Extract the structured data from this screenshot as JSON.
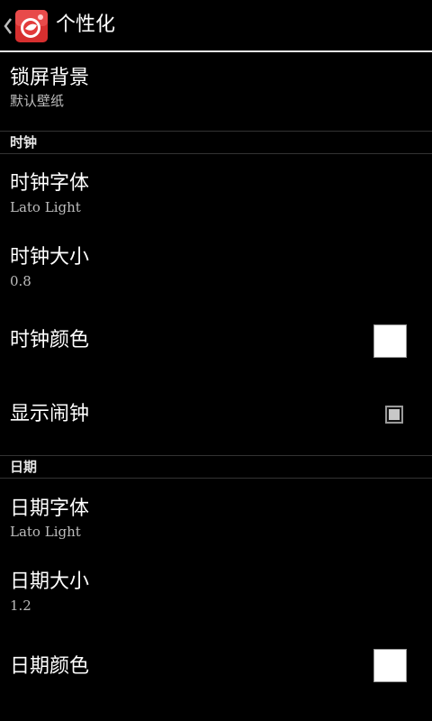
{
  "action_bar": {
    "title": "个性化",
    "app_icon": "app-logo-icon",
    "up_icon": "chevron-left-icon"
  },
  "preferences": {
    "lock_background": {
      "title": "锁屏背景",
      "summary": "默认壁纸"
    },
    "category_clock": "时钟",
    "clock_font": {
      "title": "时钟字体",
      "summary": "Lato Light"
    },
    "clock_size": {
      "title": "时钟大小",
      "summary": "0.8"
    },
    "clock_color": {
      "title": "时钟颜色",
      "color": "#ffffff"
    },
    "show_alarm": {
      "title": "显示闹钟",
      "checked": true
    },
    "category_date": "日期",
    "date_font": {
      "title": "日期字体",
      "summary": "Lato Light"
    },
    "date_size": {
      "title": "日期大小",
      "summary": "1.2"
    },
    "date_color": {
      "title": "日期颜色",
      "color": "#ffffff"
    }
  },
  "colors": {
    "background": "#000000",
    "divider": "#e6e6e6",
    "summary_text": "#bdbdbd"
  }
}
